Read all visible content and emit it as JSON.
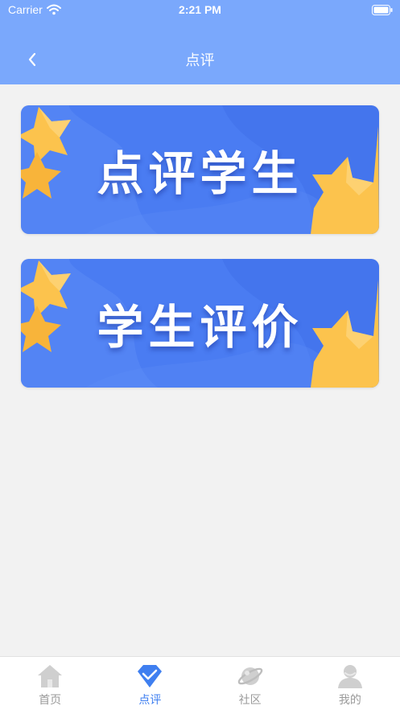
{
  "status_bar": {
    "carrier": "Carrier",
    "time": "2:21 PM",
    "wifi_icon": "wifi-icon",
    "battery_icon": "battery-icon"
  },
  "nav": {
    "back_icon": "chevron-left-icon",
    "title": "点评"
  },
  "banners": [
    {
      "label": "点评学生"
    },
    {
      "label": "学生评价"
    }
  ],
  "tabs": [
    {
      "label": "首页",
      "icon": "home-icon",
      "active": false
    },
    {
      "label": "点评",
      "icon": "check-badge-icon",
      "active": true
    },
    {
      "label": "社区",
      "icon": "planet-icon",
      "active": false
    },
    {
      "label": "我的",
      "icon": "user-icon",
      "active": false
    }
  ],
  "colors": {
    "header": "#7aa8fc",
    "background": "#f2f2f2",
    "banner_blue": "#4a7cf2",
    "star_yellow": "#fbc14a",
    "tab_active": "#3f7ff0",
    "tab_inactive": "#9a9a9a"
  }
}
